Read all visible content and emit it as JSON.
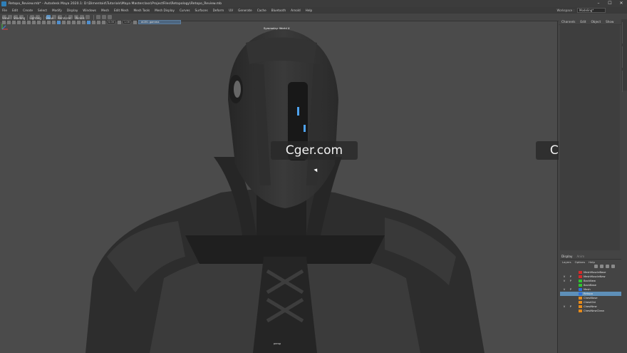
{
  "window": {
    "title": "Retopo_Review.mb* - Autodesk Maya 2020.1: D:\\Dimentoid\\Tutorials\\Maya Masterclass\\ProjectFiles\\Retopology\\Retopo_Review.mb",
    "minimize": "–",
    "maximize": "☐",
    "close": "✕"
  },
  "menubar": {
    "items": [
      "File",
      "Edit",
      "Create",
      "Select",
      "Modify",
      "Display",
      "Windows",
      "Mesh",
      "Edit Mesh",
      "Mesh Tools",
      "Mesh Display",
      "Curves",
      "Surfaces",
      "Deform",
      "UV",
      "Generate",
      "Cache",
      "Bluetooth",
      "Arnold",
      "Help"
    ],
    "workspace_label": "Workspace :",
    "workspace_value": "Modeling*"
  },
  "viewport": {
    "menu": [
      "View",
      "Shading",
      "Lighting",
      "Show",
      "Renderer",
      "Panels"
    ],
    "field1": "0.00",
    "field2": "1.00",
    "camera": "ACES: gamma",
    "hud_top": "Symmetry: World X",
    "hud_bottom": "persp"
  },
  "watermarks": [
    "Cger.com",
    "Cger.com"
  ],
  "channel_box": {
    "menu": [
      "Channels",
      "Edit",
      "Object",
      "Show"
    ]
  },
  "layer_editor": {
    "tabs": [
      "Display",
      "Anim"
    ],
    "submenu": [
      "Layers",
      "Options",
      "Help"
    ],
    "layers": [
      {
        "v": "",
        "p": "",
        "color": "#d42a2a",
        "name": "MeshMuscleBase"
      },
      {
        "v": "V",
        "p": "P",
        "color": "#d42a2a",
        "name": "MeshMuscleNew"
      },
      {
        "v": "V",
        "p": "P",
        "color": "#2fc42f",
        "name": "BackNew"
      },
      {
        "v": "",
        "p": "",
        "color": "#2fc42f",
        "name": "BackBase"
      },
      {
        "v": "V",
        "p": "P",
        "color": "#2f6fd8",
        "name": "Mesh"
      },
      {
        "v": "",
        "p": "",
        "color": "#2f6fd8",
        "name": "Retopo",
        "selected": true
      },
      {
        "v": "",
        "p": "",
        "color": "#e58a1a",
        "name": "ChestBase"
      },
      {
        "v": "",
        "p": "",
        "color": "#e58a1a",
        "name": "ChestOld"
      },
      {
        "v": "V",
        "p": "P",
        "color": "#e58a1a",
        "name": "ChestNew"
      },
      {
        "v": "",
        "p": "",
        "color": "#e58a1a",
        "name": "ChestNewClean"
      }
    ]
  }
}
